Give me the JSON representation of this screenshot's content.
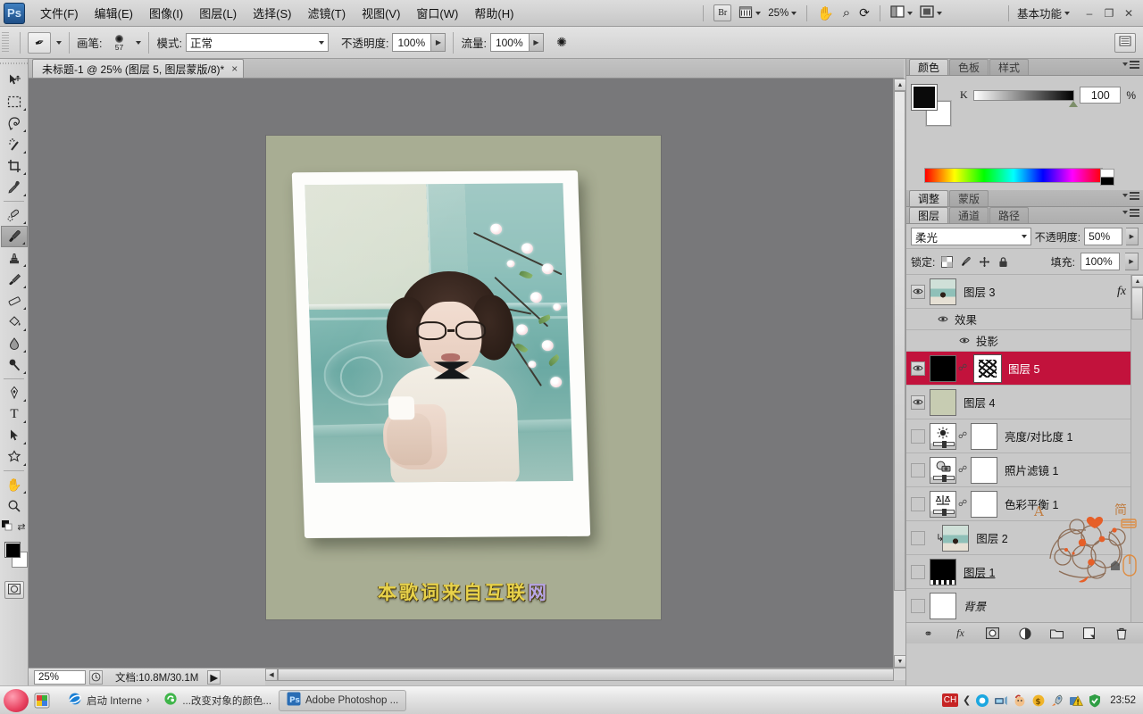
{
  "app": {
    "logo": "Ps",
    "title": "Adobe Photoshop"
  },
  "menubar": {
    "items": [
      {
        "label": "文件(F)",
        "name": "menu-file"
      },
      {
        "label": "编辑(E)",
        "name": "menu-edit"
      },
      {
        "label": "图像(I)",
        "name": "menu-image"
      },
      {
        "label": "图层(L)",
        "name": "menu-layer"
      },
      {
        "label": "选择(S)",
        "name": "menu-select"
      },
      {
        "label": "滤镜(T)",
        "name": "menu-filter"
      },
      {
        "label": "视图(V)",
        "name": "menu-view"
      },
      {
        "label": "窗口(W)",
        "name": "menu-window"
      },
      {
        "label": "帮助(H)",
        "name": "menu-help"
      }
    ],
    "bridge_label": "Br",
    "zoom_level": "25%",
    "workspace": "基本功能",
    "minimize": "–",
    "restore": "❐",
    "close": "✕"
  },
  "optionsbar": {
    "brush_label": "画笔:",
    "brush_size": "57",
    "mode_label": "模式:",
    "mode_value": "正常",
    "opacity_label": "不透明度:",
    "opacity_value": "100%",
    "flow_label": "流量:",
    "flow_value": "100%"
  },
  "toolbox": {
    "tools": [
      {
        "name": "move-tool",
        "glyph": "↖"
      },
      {
        "name": "marquee-tool",
        "glyph": "□"
      },
      {
        "name": "lasso-tool",
        "glyph": "⌇"
      },
      {
        "name": "magic-wand-tool",
        "glyph": "✲"
      },
      {
        "name": "crop-tool",
        "glyph": "⌗"
      },
      {
        "name": "eyedropper-tool",
        "glyph": "✐"
      },
      {
        "name": "healing-brush-tool",
        "glyph": "✒"
      },
      {
        "name": "brush-tool",
        "glyph": "✎",
        "active": true
      },
      {
        "name": "clone-stamp-tool",
        "glyph": "⚑"
      },
      {
        "name": "history-brush-tool",
        "glyph": "❦"
      },
      {
        "name": "eraser-tool",
        "glyph": "▱"
      },
      {
        "name": "gradient-tool",
        "glyph": "◧"
      },
      {
        "name": "blur-tool",
        "glyph": "●"
      },
      {
        "name": "dodge-tool",
        "glyph": "○"
      },
      {
        "name": "pen-tool",
        "glyph": "✑"
      },
      {
        "name": "type-tool",
        "glyph": "T"
      },
      {
        "name": "path-selection-tool",
        "glyph": "➤"
      },
      {
        "name": "shape-tool",
        "glyph": "⬟"
      },
      {
        "name": "hand-tool",
        "glyph": "✋"
      },
      {
        "name": "zoom-tool",
        "glyph": "⌕"
      }
    ],
    "foreground_color": "#000000",
    "background_color": "#ffffff",
    "quickmask_label": "○"
  },
  "document": {
    "tab_title": "未标题-1 @ 25% (图层 5, 图层蒙版/8)*",
    "close_glyph": "×",
    "canvas_subtitle": "本歌词来自互联",
    "canvas_subtitle_tail": "网",
    "canvas_background": "#a8ad93"
  },
  "statusbar": {
    "zoom_value": "25%",
    "doc_label": "文档:",
    "doc_value": "10.8M/30.1M",
    "arrow_glyph": "▶"
  },
  "color_panel": {
    "tabs": [
      {
        "label": "颜色",
        "name": "tab-color",
        "active": true
      },
      {
        "label": "色板",
        "name": "tab-swatches",
        "active": false
      },
      {
        "label": "样式",
        "name": "tab-styles",
        "active": false
      }
    ],
    "channel_label": "K",
    "channel_value": "100",
    "unit": "%"
  },
  "adjust_panel": {
    "tabs": [
      {
        "label": "调整",
        "name": "tab-adjustments",
        "active": true
      },
      {
        "label": "蒙版",
        "name": "tab-masks",
        "active": false
      }
    ]
  },
  "layers_panel": {
    "tabs": [
      {
        "label": "图层",
        "name": "tab-layers",
        "active": true
      },
      {
        "label": "通道",
        "name": "tab-channels",
        "active": false
      },
      {
        "label": "路径",
        "name": "tab-paths",
        "active": false
      }
    ],
    "blend_mode": "柔光",
    "opacity_label": "不透明度:",
    "opacity_value": "50%",
    "lock_label": "锁定:",
    "fill_label": "填充:",
    "fill_value": "100%",
    "selected_row_color": "#c2123c",
    "rows": [
      {
        "name": "图层 3",
        "kind": "image",
        "visible": true,
        "selected": false,
        "thumb": "girl",
        "has_fx": true,
        "fx_glyph": "fx"
      },
      {
        "name": "效果",
        "kind": "fx-group",
        "visible": true,
        "indent": 1
      },
      {
        "name": "投影",
        "kind": "fx-item",
        "visible": true,
        "indent": 2
      },
      {
        "name": "图层 5",
        "kind": "image-mask",
        "visible": true,
        "selected": true,
        "thumb": "black",
        "mask": "scribble"
      },
      {
        "name": "图层 4",
        "kind": "image",
        "visible": true,
        "selected": false,
        "thumb": "sage"
      },
      {
        "name": "亮度/对比度 1",
        "kind": "adjustment",
        "visible": false,
        "selected": false,
        "thumb": "brightness",
        "mask": "white"
      },
      {
        "name": "照片滤镜 1",
        "kind": "adjustment",
        "visible": false,
        "selected": false,
        "thumb": "photofilter",
        "mask": "white"
      },
      {
        "name": "色彩平衡 1",
        "kind": "adjustment",
        "visible": false,
        "selected": false,
        "thumb": "colorbalance",
        "mask": "white"
      },
      {
        "name": "图层 2",
        "kind": "image",
        "visible": false,
        "selected": false,
        "thumb": "girl2",
        "clipped": true
      },
      {
        "name": "图层 1",
        "kind": "image",
        "visible": false,
        "selected": false,
        "thumb": "blackstrip"
      },
      {
        "name": "背景",
        "kind": "background",
        "visible": false,
        "selected": false,
        "thumb": "white"
      }
    ],
    "footer_icons": [
      {
        "name": "link-layers-icon",
        "glyph": "⚭"
      },
      {
        "name": "layer-style-fx-icon",
        "glyph": "fx"
      },
      {
        "name": "add-layer-mask-icon",
        "glyph": "▢"
      },
      {
        "name": "new-adjustment-layer-icon",
        "glyph": "◑"
      },
      {
        "name": "new-group-icon",
        "glyph": "▭"
      },
      {
        "name": "new-layer-icon",
        "glyph": "⧉"
      },
      {
        "name": "delete-layer-icon",
        "glyph": "♻"
      }
    ]
  },
  "taskbar": {
    "buttons": [
      {
        "label": "启动 Interne",
        "name": "taskbar-ie",
        "active": false
      },
      {
        "label": "...改变对象的颜色...",
        "name": "taskbar-browser",
        "active": false
      },
      {
        "label": "Adobe Photoshop ...",
        "name": "taskbar-photoshop",
        "active": true
      }
    ],
    "ime": "CH",
    "clock": "23:52"
  }
}
